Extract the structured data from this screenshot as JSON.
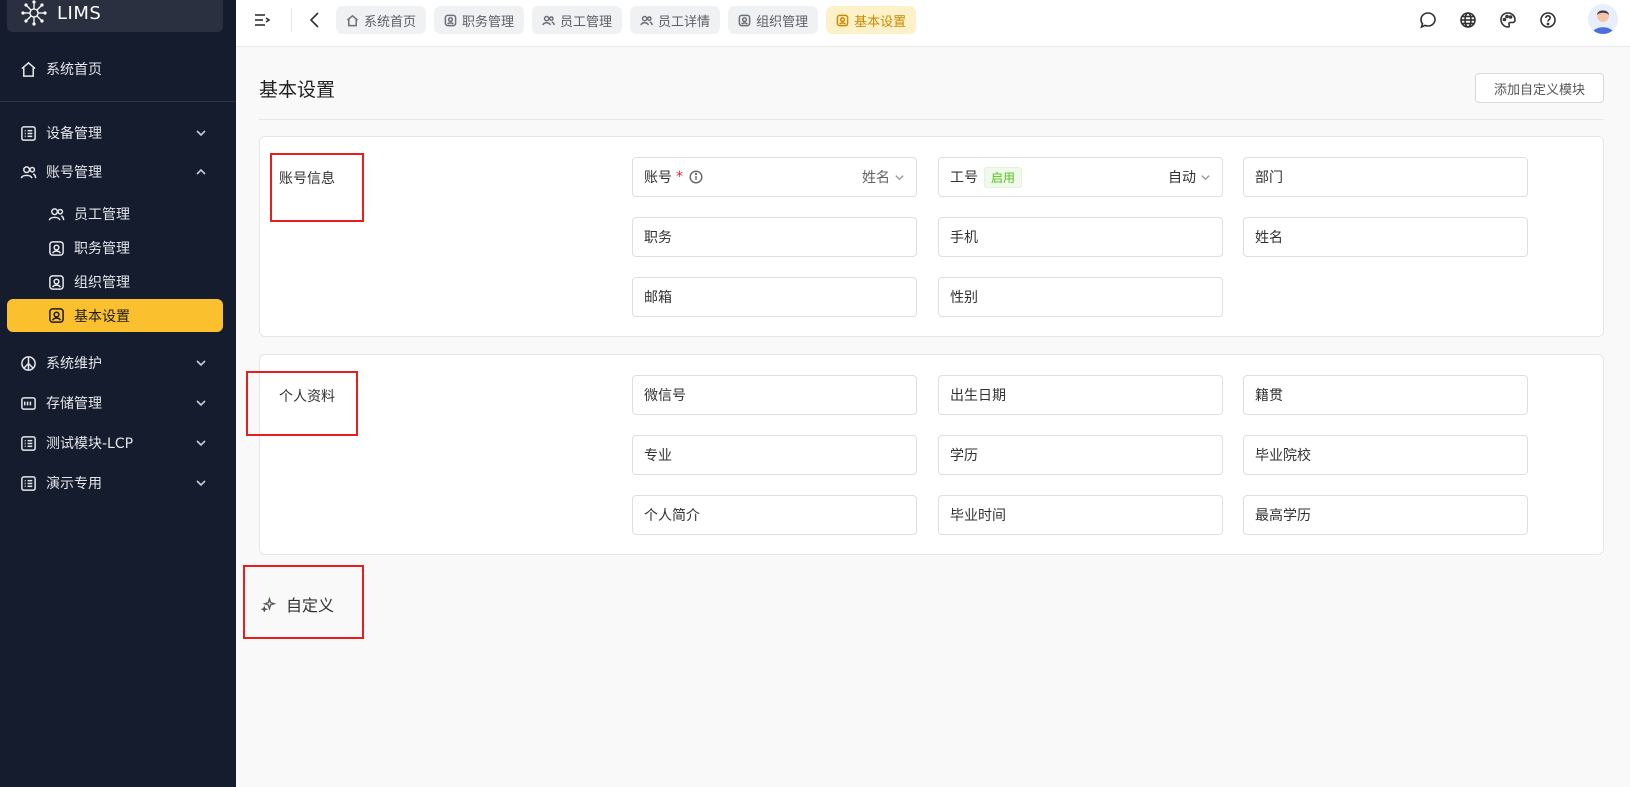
{
  "brand": {
    "name": "LIMS"
  },
  "sidebar": {
    "items": [
      {
        "label": "系统首页",
        "icon": "home-icon"
      },
      {
        "label": "设备管理",
        "icon": "list-icon"
      },
      {
        "label": "账号管理",
        "icon": "users-icon"
      },
      {
        "label": "员工管理",
        "icon": "users-icon"
      },
      {
        "label": "职务管理",
        "icon": "badge-icon"
      },
      {
        "label": "组织管理",
        "icon": "badge-icon"
      },
      {
        "label": "基本设置",
        "icon": "badge-icon"
      },
      {
        "label": "系统维护",
        "icon": "peace-icon"
      },
      {
        "label": "存储管理",
        "icon": "storage-icon"
      },
      {
        "label": "测试模块-LCP",
        "icon": "list-icon"
      },
      {
        "label": "演示专用",
        "icon": "list-icon"
      }
    ]
  },
  "topbar": {
    "tabs": [
      {
        "label": "系统首页",
        "icon": "home-icon"
      },
      {
        "label": "职务管理",
        "icon": "badge-icon"
      },
      {
        "label": "员工管理",
        "icon": "users-icon"
      },
      {
        "label": "员工详情",
        "icon": "users-icon"
      },
      {
        "label": "组织管理",
        "icon": "badge-icon"
      },
      {
        "label": "基本设置",
        "icon": "badge-icon"
      }
    ],
    "active_tab": "基本设置",
    "accent_color": "#fbc02d"
  },
  "page": {
    "title": "基本设置",
    "add_button": "添加自定义模块"
  },
  "account_section": {
    "label": "账号信息",
    "fields": {
      "account": "账号",
      "account_required": "*",
      "account_option": "姓名",
      "job_no": "工号",
      "job_no_badge": "启用",
      "job_no_option": "自动",
      "department": "部门",
      "position": "职务",
      "mobile": "手机",
      "name": "姓名",
      "email": "邮箱",
      "gender": "性别"
    }
  },
  "profile_section": {
    "label": "个人资料",
    "fields": {
      "wechat": "微信号",
      "birthday": "出生日期",
      "native_place": "籍贯",
      "major": "专业",
      "education": "学历",
      "school": "毕业院校",
      "intro": "个人简介",
      "graduation_time": "毕业时间",
      "highest_degree": "最高学历"
    }
  },
  "custom_section": {
    "label": "自定义"
  }
}
